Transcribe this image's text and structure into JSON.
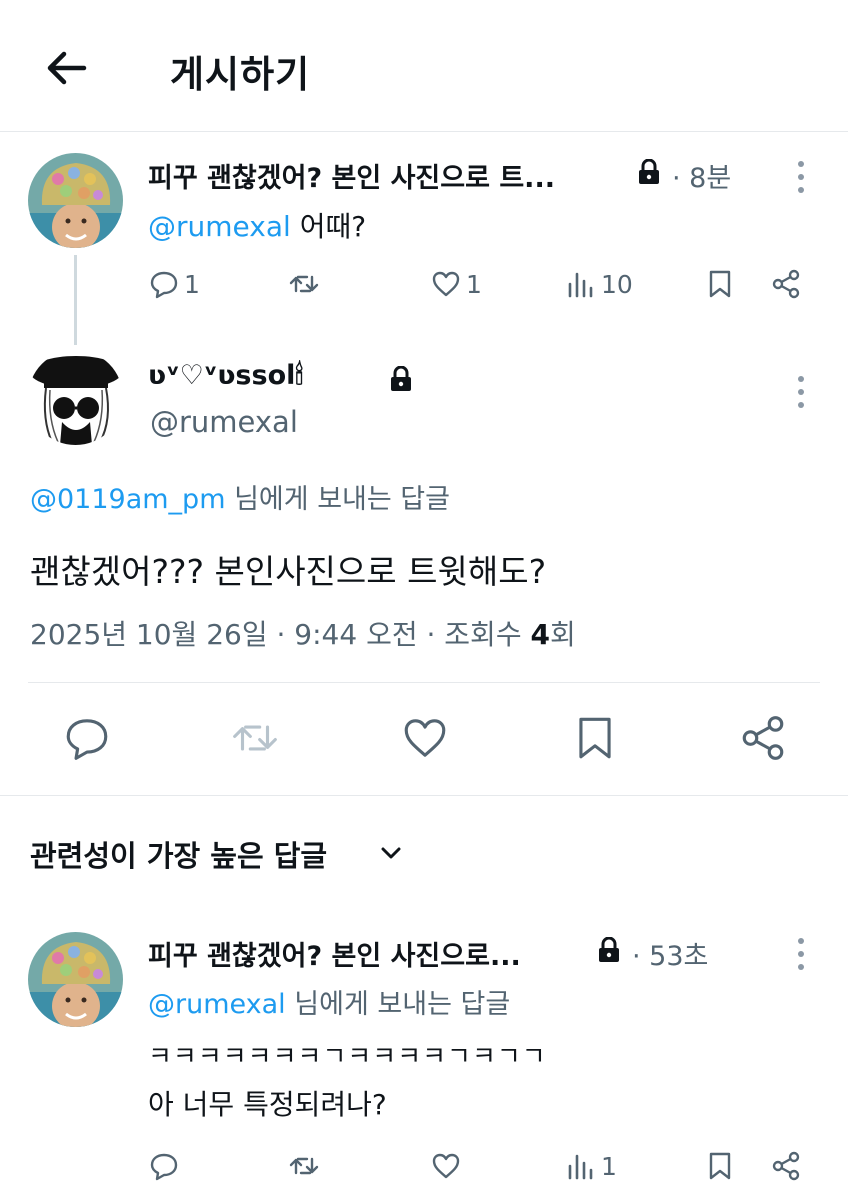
{
  "header": {
    "title": "게시하기",
    "back_icon": "arrow-left-icon"
  },
  "parent_tweet": {
    "author": "피꾸 괜찮겠어? 본인 사진으로 트...",
    "lock_icon": "lock-icon",
    "time": "· 8분",
    "mention": "@rumexal",
    "text": "어때?",
    "replies": "1",
    "retweets": "",
    "likes": "1",
    "views": "10"
  },
  "main_tweet": {
    "display_name": "ʋᵛ♡ᵛʋssol🕯",
    "handle": "@rumexal",
    "reply_to_handle": "@0119am_pm",
    "reply_to_suffix": "님에게 보내는 답글",
    "text": "괜찮겠어??? 본인사진으로 트윗해도?",
    "date": "2025년 10월 26일 · 9:44 오전 · 조회수 ",
    "views_count": "4",
    "views_unit": "회"
  },
  "sort": {
    "label": "관련성이 가장 높은 답글"
  },
  "reply_tweet": {
    "author": "피꾸 괜찮겠어? 본인 사진으로...",
    "time": "· 53초",
    "reply_to_handle": "@rumexal",
    "reply_to_suffix": "님에게 보내는 답글",
    "line1": "ㅋㅋㅋㅋㅋㅋㅋㄱㅋㅋㅋㅋㄱㅋㄱㄱ",
    "line2": "아 너무 특정되려나?",
    "replies": "",
    "retweets": "",
    "likes": "",
    "views": "1"
  },
  "colors": {
    "accent": "#1d9bf0",
    "muted": "#536471",
    "text": "#0f1419",
    "divider": "#e6e9ec"
  }
}
